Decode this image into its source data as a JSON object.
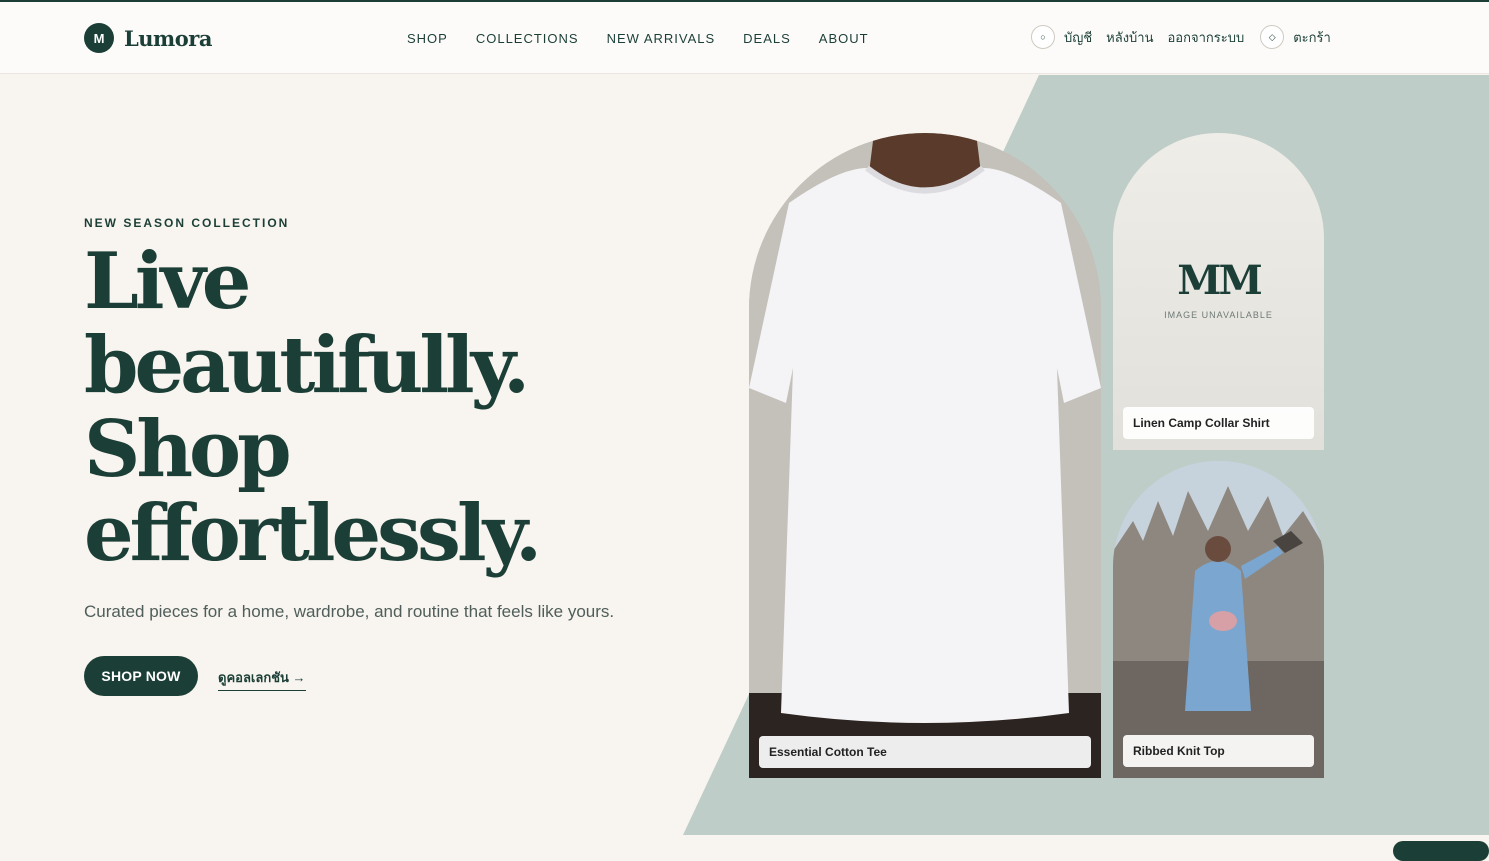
{
  "brand": {
    "badge": "M",
    "name": "Lumora"
  },
  "nav": [
    "SHOP",
    "COLLECTIONS",
    "NEW ARRIVALS",
    "DEALS",
    "ABOUT"
  ],
  "utility": {
    "account": "บัญชี",
    "backoffice": "หลังบ้าน",
    "logout": "ออกจากระบบ",
    "cart": "ตะกร้า",
    "account_icon_glyph": "○",
    "cart_icon_glyph": "◇"
  },
  "hero": {
    "eyebrow": "NEW SEASON COLLECTION",
    "headline": [
      "Live",
      "beautifully.",
      "Shop",
      "effortlessly."
    ],
    "subtitle": "Curated pieces for a home, wardrobe, and routine that feels like yours.",
    "primary_button": "SHOP NOW",
    "secondary_link": "ดูคอลเลกชัน →"
  },
  "products": [
    {
      "name": "Essential Cotton Tee",
      "image": "white-tshirt-photo"
    },
    {
      "name": "Linen Camp Collar Shirt",
      "placeholder_monogram": "MM",
      "placeholder_text": "IMAGE UNAVAILABLE"
    },
    {
      "name": "Ribbed Knit Top",
      "image": "woman-in-blue-coat-photo"
    }
  ],
  "colors": {
    "brand_green": "#1b3f37",
    "hero_bg": "#f8f4ef",
    "accent_panel": "#bfcdc8"
  }
}
